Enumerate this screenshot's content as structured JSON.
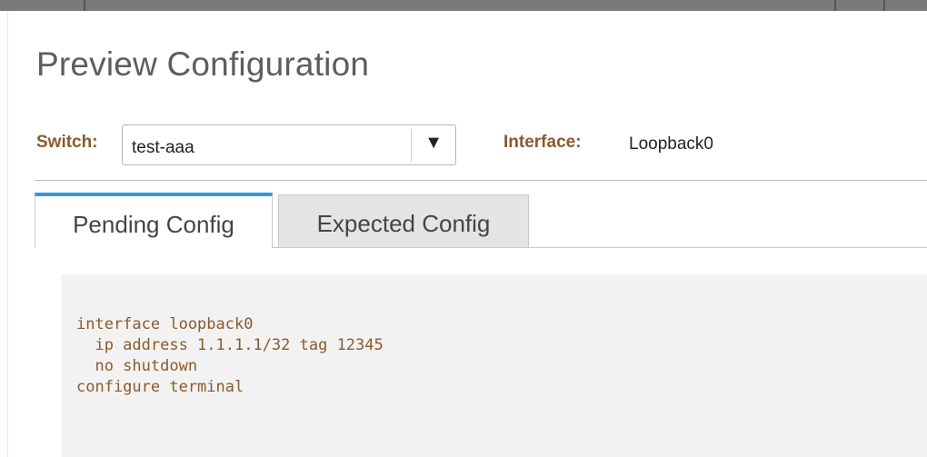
{
  "dialog": {
    "title": "Preview Configuration"
  },
  "filters": {
    "switch_label": "Switch:",
    "switch_value": "test-aaa",
    "switch_arrow": "▼",
    "interface_label": "Interface:",
    "interface_value": "Loopback0"
  },
  "tabs": [
    {
      "label": "Pending Config",
      "active": true
    },
    {
      "label": "Expected Config",
      "active": false
    }
  ],
  "config": {
    "lines": [
      "interface loopback0",
      "  ip address 1.1.1.1/32 tag 12345",
      "  no shutdown",
      "configure terminal"
    ]
  },
  "colors": {
    "accent": "#2b9be0",
    "label": "#8a5a2b",
    "code_text": "#8a5a2b",
    "code_bg": "#f3f2f2"
  }
}
